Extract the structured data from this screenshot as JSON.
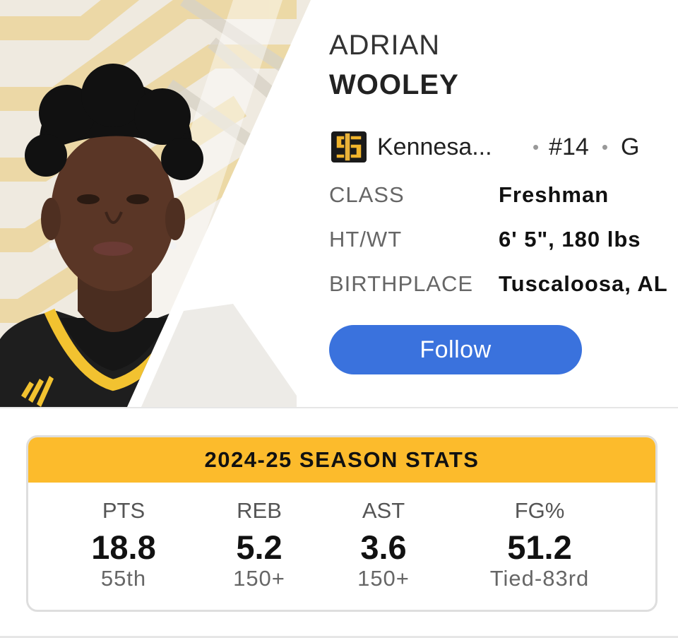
{
  "player": {
    "first_name": "ADRIAN",
    "last_name": "WOOLEY",
    "team": "Kennesa...",
    "number": "#14",
    "position": "G",
    "details": [
      {
        "key": "CLASS",
        "value": "Freshman"
      },
      {
        "key": "HT/WT",
        "value": "6' 5\", 180 lbs"
      },
      {
        "key": "BIRTHPLACE",
        "value": "Tuscaloosa, AL"
      }
    ],
    "follow_label": "Follow"
  },
  "icons": {
    "team_logo": "team-logo-icon",
    "separator": "•"
  },
  "season_stats": {
    "title": "2024-25 SEASON STATS",
    "stats": [
      {
        "label": "PTS",
        "value": "18.8",
        "rank": "55th"
      },
      {
        "label": "REB",
        "value": "5.2",
        "rank": "150+"
      },
      {
        "label": "AST",
        "value": "3.6",
        "rank": "150+"
      },
      {
        "label": "FG%",
        "value": "51.2",
        "rank": "Tied-83rd"
      }
    ]
  },
  "colors": {
    "accent_blue": "#3a72dd",
    "header_gold": "#fcbb2c",
    "team_gold": "#e9b23a"
  }
}
